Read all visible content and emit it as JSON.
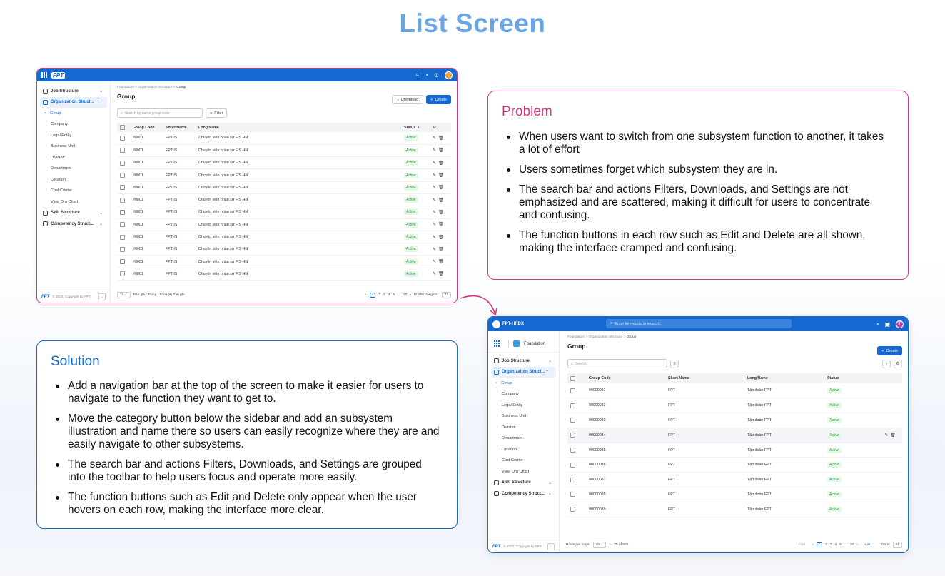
{
  "page_title": "List Screen",
  "old_ui": {
    "brand": "FPT",
    "sidebar": {
      "groups": [
        {
          "label": "Job Structure"
        },
        {
          "label": "Organization Struct..."
        },
        {
          "label": "Skill Structure"
        },
        {
          "label": "Competency Struct..."
        }
      ],
      "subitems": [
        "Group",
        "Company",
        "Legal Entity",
        "Business Unit",
        "Division",
        "Department",
        "Location",
        "Cost Center",
        "View Org Chart"
      ],
      "footer": "© 2024, Copyright by FPT"
    },
    "breadcrumb": [
      "Foundation",
      "Organization Structure",
      "Group"
    ],
    "title": "Group",
    "download_label": "Download",
    "create_label": "Create",
    "search_placeholder": "Search by name group code",
    "filter_label": "Filter",
    "columns": [
      "Group Code",
      "Short Name",
      "Long Name",
      "Status"
    ],
    "row": {
      "code": "#0001",
      "short": "FPT IS",
      "long": "Chuyên viên nhân sự FIS HN",
      "status": "Active"
    },
    "pager": {
      "per_page": "10",
      "per_page_text": "Bản ghi / Trang",
      "total_text": "Tổng [#] Bản ghi",
      "pages": [
        "1",
        "2",
        "3",
        "4",
        "5",
        "...",
        "20"
      ],
      "goto_text": "Đi đến trang thứ",
      "goto_value": "22"
    }
  },
  "problem": {
    "heading": "Problem",
    "items": [
      "When users want to switch from one subsystem function to another, it takes a lot of effort",
      "Users sometimes forget which subsystem they are in.",
      "The search bar and actions Filters, Downloads, and Settings are not emphasized and are scattered, making it difficult for users to concentrate and confusing.",
      "The function buttons in each row such as Edit and Delete are all shown, making the interface cramped and confusing."
    ]
  },
  "solution": {
    "heading": "Solution",
    "items": [
      "Add a navigation bar at the top of the screen to make it easier for users to navigate to the function they want to get to.",
      "Move the category button below the sidebar and add an subsystem illustration and name there so users can easily recognize where they are and easily navigate to other subsystems.",
      "The search bar and actions Filters, Downloads, and Settings are grouped into the toolbar to help users focus and operate more easily.",
      "The function buttons such as Edit and Delete only appear when the user hovers on each row, making the interface more clear."
    ]
  },
  "new_ui": {
    "brand": "FPT-HRDX",
    "search_placeholder": "Enter keywords to search...",
    "avatar_letter": "T",
    "subsystem": "Foundation",
    "sidebar": {
      "groups": [
        {
          "label": "Job Structure"
        },
        {
          "label": "Organization Struct..."
        },
        {
          "label": "Skill Structure"
        },
        {
          "label": "Competency Struct..."
        }
      ],
      "subitems": [
        "Group",
        "Company",
        "Legal Entity",
        "Business Unit",
        "Division",
        "Department",
        "Location",
        "Cost Center",
        "View Org Chart"
      ],
      "footer": "© 2024, Copyright by FPT"
    },
    "breadcrumb": [
      "Foundation",
      "Organization Structure",
      "Group"
    ],
    "title": "Group",
    "create_label": "Create",
    "toolbar_search": "Search",
    "columns": [
      "Group Code",
      "Short Name",
      "Long Name",
      "Status"
    ],
    "rows": [
      {
        "code": "00000031",
        "short": "FPT",
        "long": "Tập đoàn FPT",
        "status": "Active"
      },
      {
        "code": "00000032",
        "short": "FPT",
        "long": "Tập đoàn FPT",
        "status": "Active"
      },
      {
        "code": "00000033",
        "short": "FPT",
        "long": "Tập đoàn FPT",
        "status": "Active"
      },
      {
        "code": "00000034",
        "short": "FPT",
        "long": "Tập đoàn FPT",
        "status": "Active"
      },
      {
        "code": "00000035",
        "short": "FPT",
        "long": "Tập đoàn FPT",
        "status": "Active"
      },
      {
        "code": "00000036",
        "short": "FPT",
        "long": "Tập đoàn FPT",
        "status": "Active"
      },
      {
        "code": "00000037",
        "short": "FPT",
        "long": "Tập đoàn FPT",
        "status": "Active"
      },
      {
        "code": "00000038",
        "short": "FPT",
        "long": "Tập đoàn FPT",
        "status": "Active"
      },
      {
        "code": "00000039",
        "short": "FPT",
        "long": "Tập đoàn FPT",
        "status": "Active"
      }
    ],
    "pager": {
      "rows_label": "Rows per page:",
      "per_page": "25",
      "range": "1 - 25 of 500",
      "first": "First",
      "last": "Last",
      "pages": [
        "1",
        "2",
        "3",
        "4",
        "5",
        "...",
        "20"
      ],
      "goto_label": "Go to",
      "goto_value": "01"
    }
  }
}
